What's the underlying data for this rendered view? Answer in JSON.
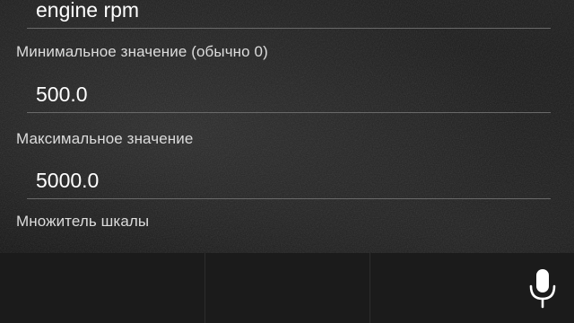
{
  "form": {
    "fields": [
      {
        "value": "engine rpm",
        "placeholder": ""
      },
      {
        "label": "Минимальное значение (обычно 0)",
        "value": "500.0"
      },
      {
        "label": "Максимальное значение",
        "value": "5000.0"
      },
      {
        "label": "Множитель шкалы"
      }
    ]
  },
  "keyboard": {
    "suggestions": [
      "",
      "",
      ""
    ],
    "mic_icon": "microphone-icon"
  },
  "colors": {
    "background": "#151515",
    "text": "#ffffff",
    "label": "#dcdcdc",
    "underline": "#6a6a6a",
    "keyboard_bar": "#1b1b1b"
  }
}
